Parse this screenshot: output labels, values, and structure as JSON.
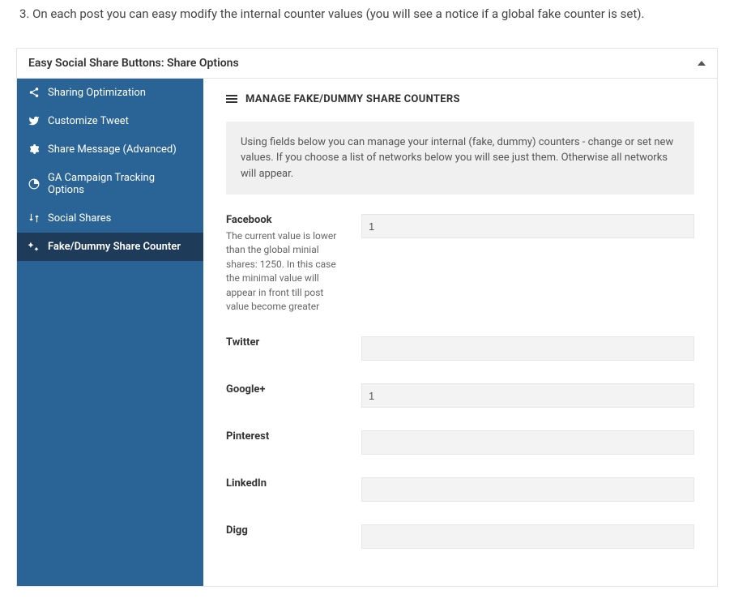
{
  "instruction": "3. On each post you can easy modify the internal counter values (you will see a notice if a global fake counter is set).",
  "panel": {
    "title": "Easy Social Share Buttons: Share Options"
  },
  "sidebar": {
    "items": [
      {
        "icon": "share-icon",
        "label": "Sharing Optimization",
        "active": false
      },
      {
        "icon": "twitter-icon",
        "label": "Customize Tweet",
        "active": false
      },
      {
        "icon": "gear-icon",
        "label": "Share Message (Advanced)",
        "active": false
      },
      {
        "icon": "analytics-icon",
        "label": "GA Campaign Tracking Options",
        "active": false
      },
      {
        "icon": "sort-icon",
        "label": "Social Shares",
        "active": false
      },
      {
        "icon": "sparkle-icon",
        "label": "Fake/Dummy Share Counter",
        "active": true
      }
    ]
  },
  "section": {
    "title": "MANAGE FAKE/DUMMY SHARE COUNTERS",
    "info": "Using fields below you can manage your internal (fake, dummy) counters - change or set new values. If you choose a list of networks below you will see just them. Otherwise all networks will appear."
  },
  "fields": [
    {
      "label": "Facebook",
      "hint": "The current value is lower than the global minial shares: 1250. In this case the minimal value will appear in front till post value become greater",
      "value": "1"
    },
    {
      "label": "Twitter",
      "hint": "",
      "value": ""
    },
    {
      "label": "Google+",
      "hint": "",
      "value": "1"
    },
    {
      "label": "Pinterest",
      "hint": "",
      "value": ""
    },
    {
      "label": "LinkedIn",
      "hint": "",
      "value": ""
    },
    {
      "label": "Digg",
      "hint": "",
      "value": ""
    }
  ]
}
